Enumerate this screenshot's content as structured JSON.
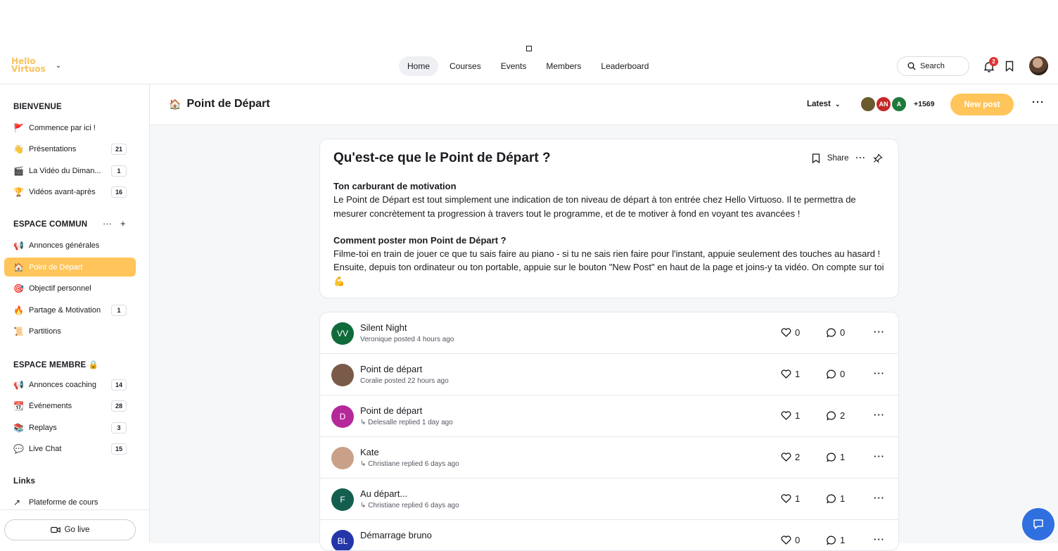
{
  "logo": {
    "line1": "Hello",
    "line2": "Virtuos"
  },
  "nav": [
    {
      "label": "Home",
      "active": true
    },
    {
      "label": "Courses"
    },
    {
      "label": "Events"
    },
    {
      "label": "Members"
    },
    {
      "label": "Leaderboard"
    }
  ],
  "search": {
    "placeholder": "Search"
  },
  "notifications": {
    "count": "2"
  },
  "sidebar": {
    "bienvenue": {
      "title": "BIENVENUE",
      "items": [
        {
          "emoji": "🚩",
          "label": "Commence par ici !",
          "count": ""
        },
        {
          "emoji": "👋",
          "label": "Présentations",
          "count": "21"
        },
        {
          "emoji": "🎬",
          "label": "La Vidéo du Diman...",
          "count": "1"
        },
        {
          "emoji": "🏆",
          "label": "Vidéos avant-après",
          "count": "16"
        }
      ]
    },
    "commun": {
      "title": "ESPACE COMMUN",
      "items": [
        {
          "emoji": "📢",
          "label": "Annonces générales",
          "count": ""
        },
        {
          "emoji": "🏠",
          "label": "Point de Départ",
          "count": "",
          "active": true
        },
        {
          "emoji": "🎯",
          "label": "Objectif personnel",
          "count": ""
        },
        {
          "emoji": "🔥",
          "label": "Partage & Motivation",
          "count": "1"
        },
        {
          "emoji": "📜",
          "label": "Partitions",
          "count": ""
        }
      ]
    },
    "membre": {
      "title": "ESPACE MEMBRE 🔒",
      "items": [
        {
          "emoji": "📢",
          "label": "Annonces coaching",
          "count": "14"
        },
        {
          "emoji": "📆",
          "label": "Événements",
          "count": "28"
        },
        {
          "emoji": "📚",
          "label": "Replays",
          "count": "3"
        },
        {
          "emoji": "💬",
          "label": "Live Chat",
          "count": "15"
        }
      ]
    },
    "links": {
      "title": "Links",
      "items": [
        {
          "emoji": "↗",
          "label": "Plateforme de cours",
          "count": ""
        }
      ]
    },
    "golive": "Go live"
  },
  "space": {
    "emoji": "🏠",
    "title": "Point de Départ",
    "sort": "Latest",
    "member_count": "+1569",
    "member_avatars": [
      {
        "initials": "",
        "color": "#6b5a2e"
      },
      {
        "initials": "AN",
        "color": "#c62828"
      },
      {
        "initials": "A",
        "color": "#1f7a3a"
      }
    ],
    "new_post": "New post"
  },
  "intro": {
    "title": "Qu'est-ce que le Point de Départ ?",
    "share": "Share",
    "heading1": "Ton carburant de motivation",
    "para1": "Le Point de Départ est tout simplement une indication de ton niveau de départ à ton entrée chez Hello Virtuoso. Il te permettra de mesurer concrètement ta progression à travers tout le programme, et de te motiver à fond en voyant tes avancées !",
    "heading2": "Comment poster mon Point de Départ ?",
    "para2": "Filme-toi en train de jouer ce que tu sais faire au piano - si tu ne sais rien faire pour l'instant, appuie seulement des touches au hasard ! Ensuite, depuis ton ordinateur ou ton portable, appuie sur le bouton \"New Post\" en haut de la page et joins-y ta vidéo. On compte sur toi 💪"
  },
  "posts": [
    {
      "title": "Silent Night",
      "meta": "Veronique posted 4 hours ago",
      "initials": "VV",
      "color": "#0f6b3a",
      "likes": "0",
      "comments": "0"
    },
    {
      "title": "Point de départ",
      "meta": "Coralie posted 22 hours ago",
      "initials": "",
      "color": "#7a5a48",
      "likes": "1",
      "comments": "0"
    },
    {
      "title": "Point de départ",
      "meta": "↳ Delesalle replied 1 day ago",
      "initials": "D",
      "color": "#b5289a",
      "likes": "1",
      "comments": "2"
    },
    {
      "title": "Kate",
      "meta": "↳ Christiane replied 6 days ago",
      "initials": "",
      "color": "#c9a189",
      "likes": "2",
      "comments": "1"
    },
    {
      "title": "Au départ...",
      "meta": "↳ Christiane replied 6 days ago",
      "initials": "F",
      "color": "#135e4f",
      "likes": "1",
      "comments": "1"
    },
    {
      "title": "Démarrage bruno",
      "meta": "",
      "initials": "BL",
      "color": "#2436a8",
      "likes": "0",
      "comments": "1"
    }
  ]
}
